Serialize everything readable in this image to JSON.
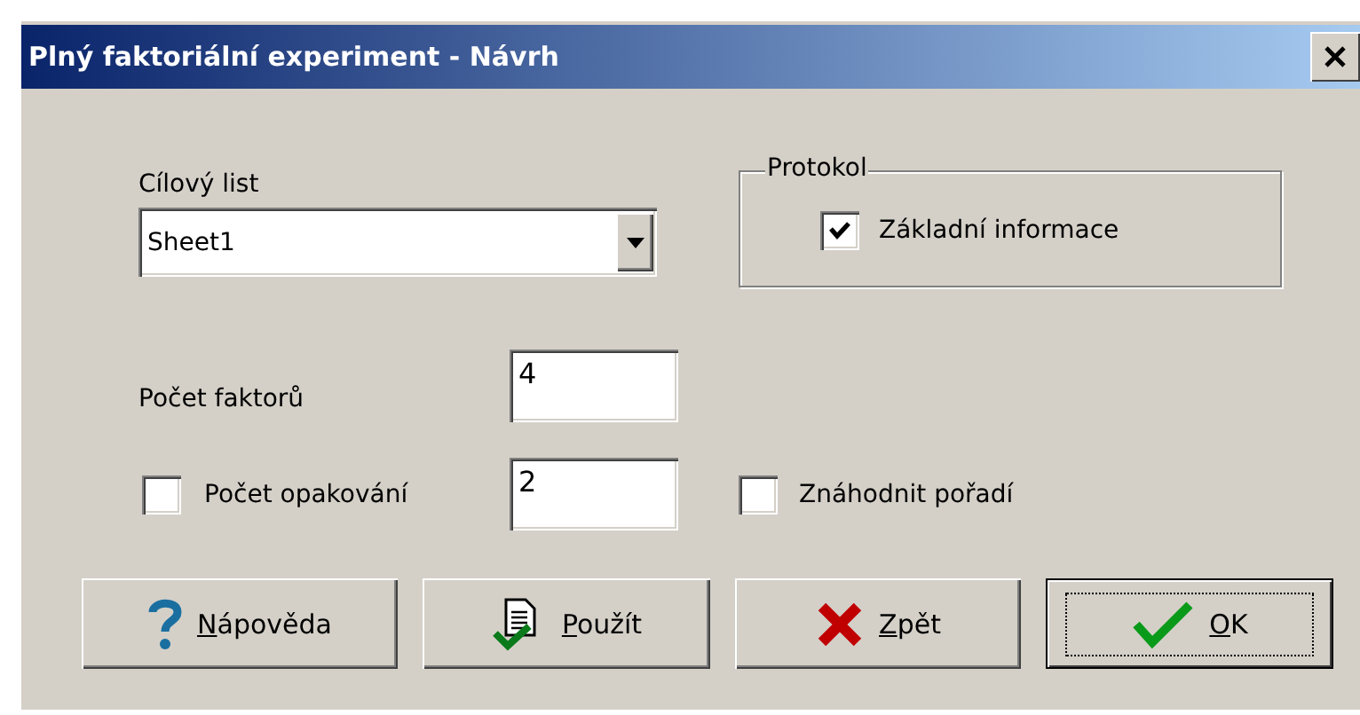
{
  "window": {
    "title": "Plný faktoriální experiment - Návrh"
  },
  "target_sheet": {
    "label": "Cílový list",
    "value": "Sheet1"
  },
  "protocol": {
    "title": "Protokol",
    "option": {
      "label": "Základní informace",
      "checked": true
    }
  },
  "factor_count": {
    "label": "Počet faktorů",
    "value": "4"
  },
  "repeat_count": {
    "label": "Počet opakování",
    "checked": false,
    "value": "2"
  },
  "randomize": {
    "label": "Znáhodnit pořadí",
    "checked": false
  },
  "buttons": [
    {
      "kind": "help",
      "mnemonic": "N",
      "rest": "ápověda",
      "default": false
    },
    {
      "kind": "apply",
      "mnemonic": "P",
      "rest": "oužít",
      "default": false
    },
    {
      "kind": "cancel",
      "mnemonic": "Z",
      "rest": "pět",
      "default": false
    },
    {
      "kind": "ok",
      "mnemonic": "O",
      "rest": "K",
      "default": true
    }
  ]
}
